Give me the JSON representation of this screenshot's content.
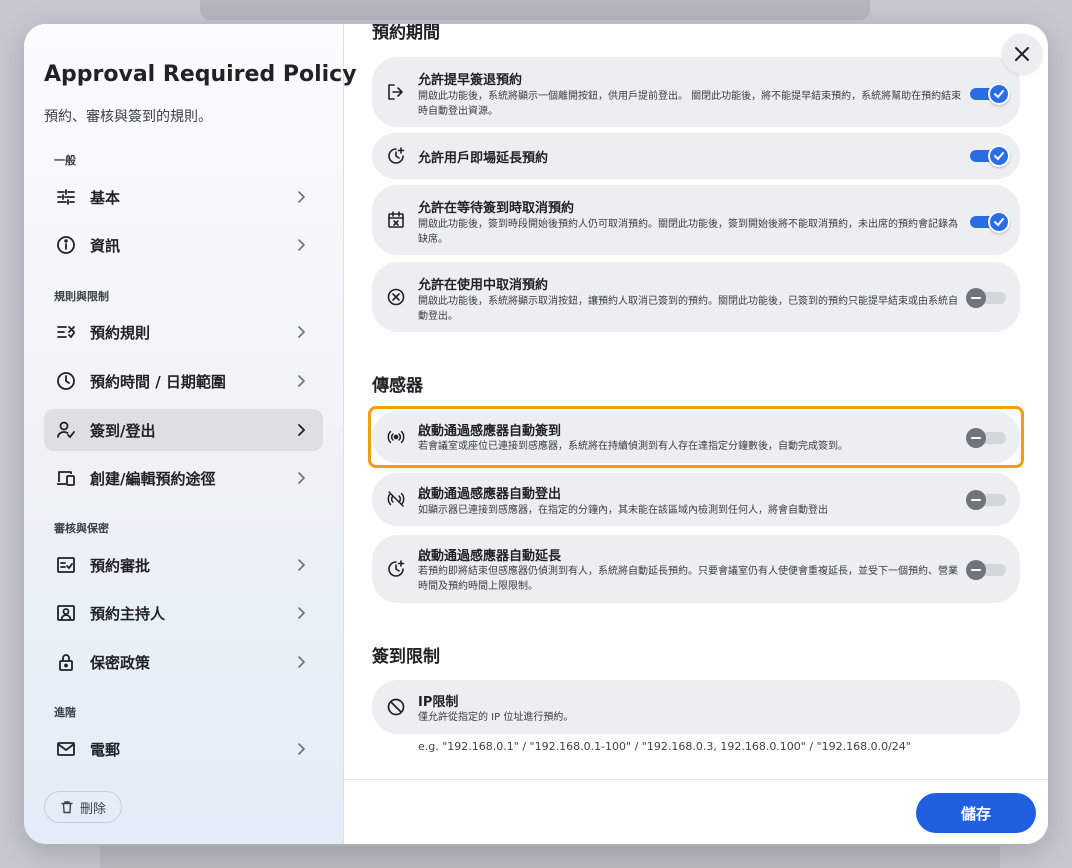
{
  "dialog": {
    "title": "Approval Required Policy",
    "subtitle": "預約、審核與簽到的規則。",
    "close_icon": "close-icon"
  },
  "sidebar": {
    "sections": [
      {
        "label": "一般"
      },
      {
        "label": "規則與限制"
      },
      {
        "label": "審核與保密"
      },
      {
        "label": "進階"
      }
    ],
    "items": [
      {
        "label": "基本",
        "icon": "sliders-icon"
      },
      {
        "label": "資訊",
        "icon": "info-icon"
      },
      {
        "label": "預約規則",
        "icon": "rules-icon"
      },
      {
        "label": "預約時間 / 日期範圍",
        "icon": "clock-icon"
      },
      {
        "label": "簽到/登出",
        "icon": "person-check-icon",
        "active": true
      },
      {
        "label": "創建/編輯預約途徑",
        "icon": "devices-icon"
      },
      {
        "label": "預約審批",
        "icon": "approval-icon"
      },
      {
        "label": "預約主持人",
        "icon": "host-icon"
      },
      {
        "label": "保密政策",
        "icon": "lock-icon"
      },
      {
        "label": "電郵",
        "icon": "mail-icon"
      }
    ],
    "delete_label": "刪除"
  },
  "main": {
    "sections": {
      "period": "預約期間",
      "sensors": "傳感器",
      "checkin_limit": "簽到限制"
    },
    "period_cards": [
      {
        "title": "允許提早簽退預約",
        "desc": "開啟此功能後，系統將顯示一個離開按鈕，供用戶提前登出。 關閉此功能後，將不能提早結束預約，系統將幫助在預約結束時自動登出資源。",
        "enabled": true,
        "icon": "logout-icon"
      },
      {
        "title": "允許用戶即場延長預約",
        "desc": "",
        "enabled": true,
        "icon": "extend-time-icon"
      },
      {
        "title": "允許在等待簽到時取消預約",
        "desc": "開啟此功能後，簽到時段開始後預約人仍可取消預約。關閉此功能後，簽到開始後將不能取消預約，未出席的預約會記錄為缺席。",
        "enabled": true,
        "icon": "calendar-cancel-icon"
      },
      {
        "title": "允許在使用中取消預約",
        "desc": "開啟此功能後，系統將顯示取消按鈕，讓預約人取消已簽到的預約。關閉此功能後，已簽到的預約只能提早結束或由系統自動登出。",
        "enabled": false,
        "icon": "cancel-circle-icon"
      }
    ],
    "sensor_cards": [
      {
        "title": "啟動通過感應器自動簽到",
        "desc": "若會議室或座位已連接到感應器，系統將在持續偵測到有人存在達指定分鐘數後，自動完成簽到。",
        "enabled": false,
        "icon": "sensor-icon"
      },
      {
        "title": "啟動通過感應器自動登出",
        "desc": "如顯示器已連接到感應器，在指定的分鐘內，其未能在該區域內檢測到任何人，將會自動登出",
        "enabled": false,
        "icon": "sensor-off-icon"
      },
      {
        "title": "啟動通過感應器自動延長",
        "desc": "若預約即將結束但感應器仍偵測到有人，系統將自動延長預約。只要會議室仍有人使便會重複延長，並受下一個預約、營業時間及預約時間上限限制。",
        "enabled": false,
        "icon": "sensor-extend-icon"
      }
    ],
    "limit_cards": [
      {
        "title": "IP限制",
        "desc": "僅允許從指定的 IP 位址進行預約。",
        "icon": "block-icon"
      }
    ],
    "ip_hint": "e.g. \"192.168.0.1\" / \"192.168.0.1-100\" / \"192.168.0.3, 192.168.0.100\" / \"192.168.0.0/24\""
  },
  "footer": {
    "save_label": "儲存"
  },
  "colors": {
    "accent": "#1f5fe0",
    "toggle_on": "#2a6ee6",
    "highlight": "#f39b12"
  }
}
